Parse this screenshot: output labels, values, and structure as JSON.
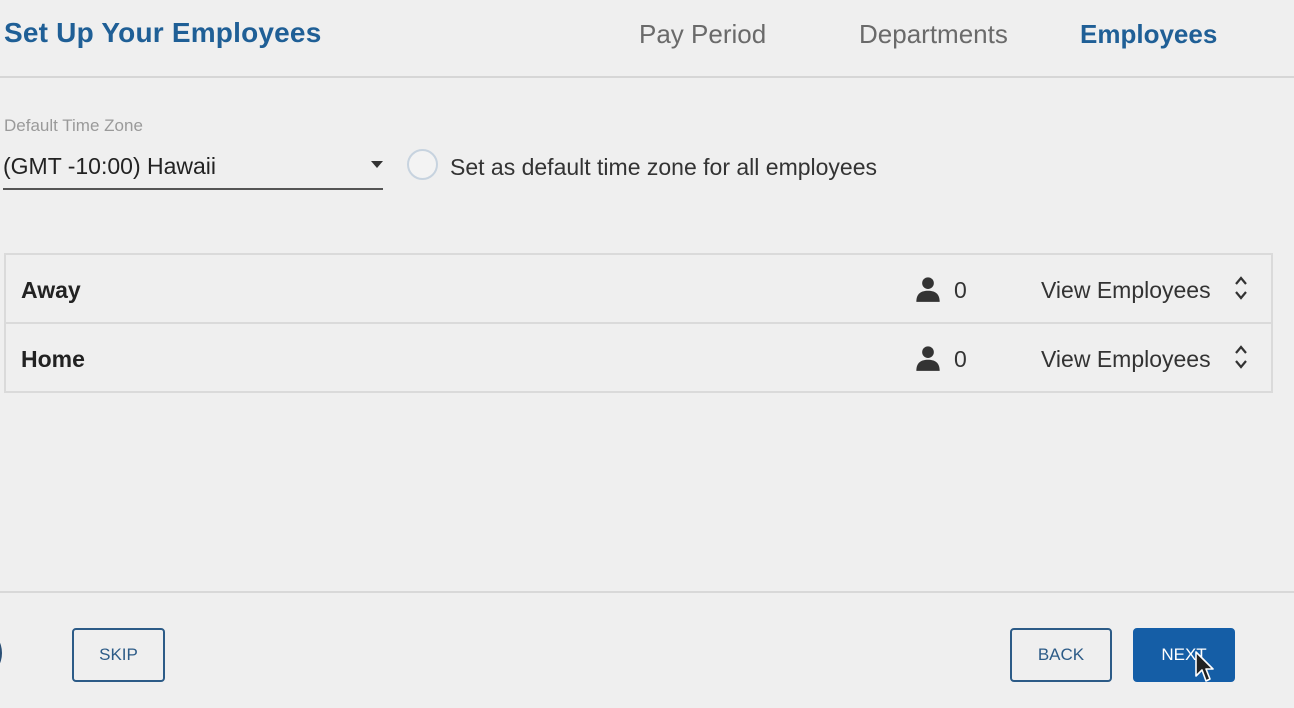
{
  "header": {
    "title": "Set Up Your Employees",
    "steps": [
      {
        "label": "Pay Period",
        "active": false
      },
      {
        "label": "Departments",
        "active": false
      },
      {
        "label": "Employees",
        "active": true
      }
    ]
  },
  "time_zone": {
    "label": "Default Time Zone",
    "selected": "(GMT -10:00) Hawaii",
    "set_default_label": "Set as default time zone for all employees",
    "set_default_checked": false
  },
  "departments": [
    {
      "name": "Away",
      "employee_count": "0",
      "action_label": "View Employees"
    },
    {
      "name": "Home",
      "employee_count": "0",
      "action_label": "View Employees"
    }
  ],
  "footer": {
    "skip_label": "SKIP",
    "back_label": "BACK",
    "next_label": "NEXT"
  },
  "icons": {
    "person": "person-icon",
    "sort": "sort-arrows-icon",
    "dropdown": "caret-down-icon",
    "cursor": "mouse-pointer-icon"
  },
  "colors": {
    "accent": "#1f5f96",
    "primary_button": "#155ea6",
    "background": "#efefef"
  }
}
